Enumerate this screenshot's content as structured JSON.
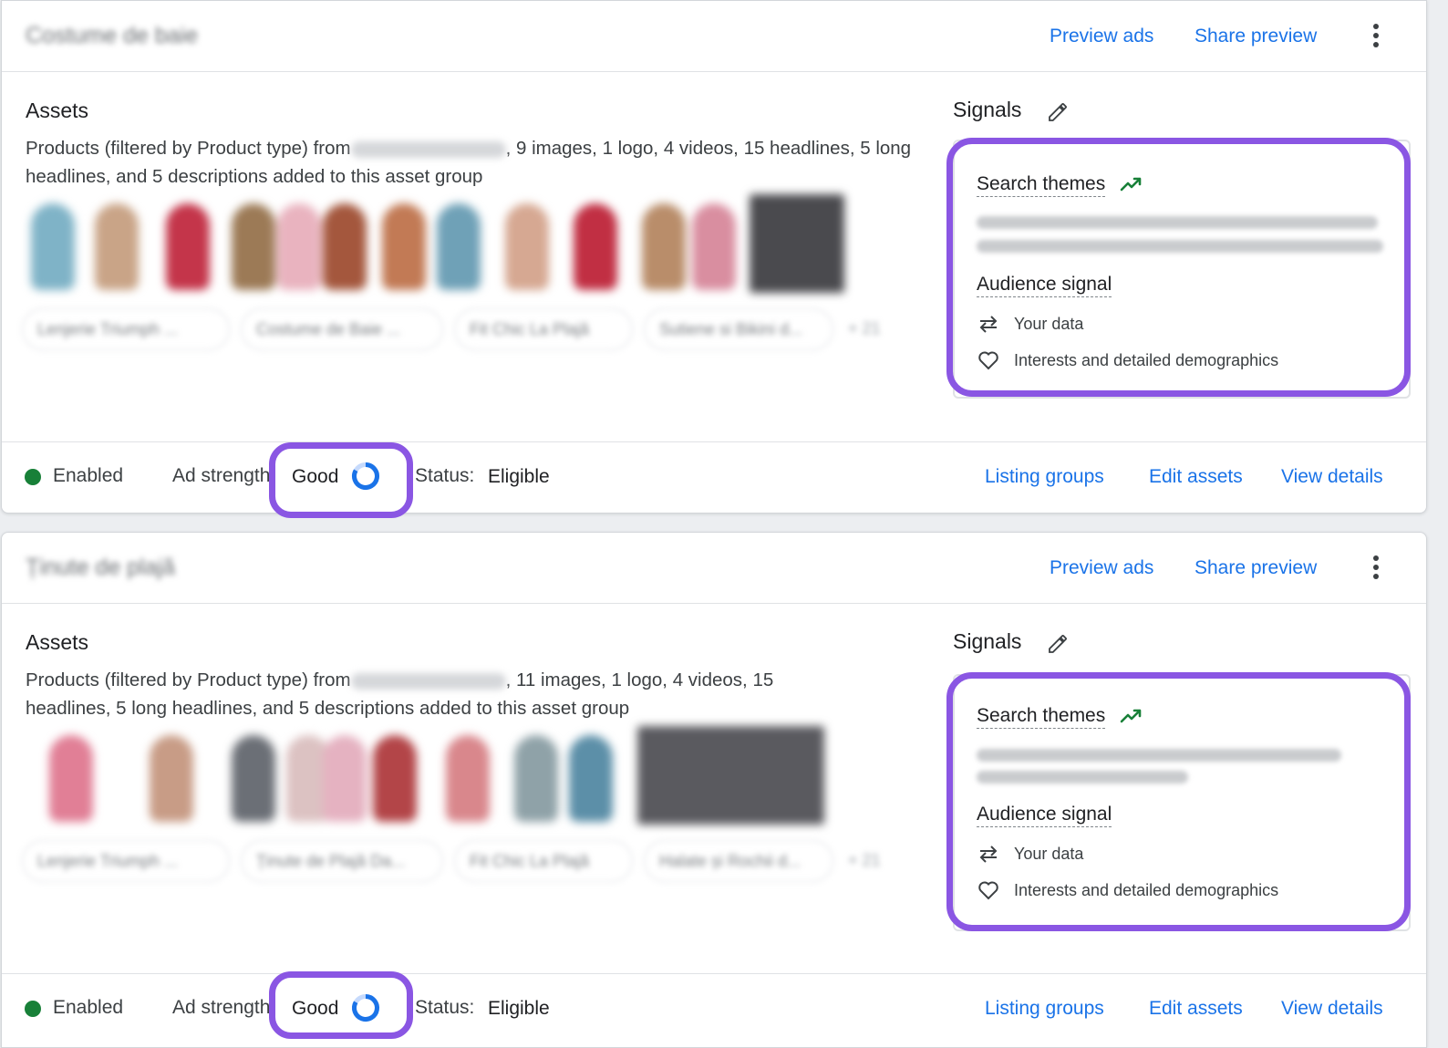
{
  "colors": {
    "link": "#1a73e8",
    "enabled_dot": "#188038",
    "highlight": "#8a56e3",
    "trend": "#188038"
  },
  "groups": [
    {
      "header": {
        "name": "Costume de baie",
        "preview_ads": "Preview ads",
        "share_preview": "Share preview",
        "more_icon": "more-vert-icon"
      },
      "assets": {
        "title": "Assets",
        "desc_prefix": "Products (filtered by Product type) from",
        "desc_source": "Lenjerie Triumph",
        "desc_suffix": ", 9 images, 1 logo, 4 videos, 15 headlines, 5 long headlines, and 5 descriptions added to this asset group",
        "product_chips": [
          "Lenjerie Triumph ...",
          "Costume de Baie ...",
          "Fit Chic La Plajă",
          "Sutiene si Bikini d..."
        ],
        "more_count": "+ 21"
      },
      "signals": {
        "title": "Signals",
        "search_themes": "Search themes",
        "themes_text": "costume de baie, costum de baie triumph, costume de baie întregi, costume de baie 2 piese, and 7 more",
        "audience_signal": "Audience signal",
        "your_data": "Your data",
        "interests": "Interests and detailed demographics"
      },
      "footer": {
        "status_enabled": "Enabled",
        "ad_strength_label": "Ad strength",
        "ad_strength_value": "Good",
        "status_label": "Status:",
        "status_value": "Eligible",
        "listing_groups": "Listing groups",
        "edit_assets": "Edit assets",
        "view_details": "View details"
      }
    },
    {
      "header": {
        "name": "Ținute de plajă",
        "preview_ads": "Preview ads",
        "share_preview": "Share preview",
        "more_icon": "more-vert-icon"
      },
      "assets": {
        "title": "Assets",
        "desc_prefix": "Products (filtered by Product type) from",
        "desc_source": "Lenjerie Triumph",
        "desc_suffix": ", 11 images, 1 logo, 4 videos, 15 headlines, 5 long headlines, and 5 descriptions added to this asset group",
        "product_chips": [
          "Lenjerie Triumph ...",
          "Ținute de Plajă Da...",
          "Fit Chic La Plajă",
          "Halate și Rochii d..."
        ],
        "more_count": "+ 21"
      },
      "signals": {
        "title": "Signals",
        "search_themes": "Search themes",
        "themes_text": "rochie de vara, rochii de plaja, kimono de plaja, halate de plaja, and 3 more",
        "audience_signal": "Audience signal",
        "your_data": "Your data",
        "interests": "Interests and detailed demographics"
      },
      "footer": {
        "status_enabled": "Enabled",
        "ad_strength_label": "Ad strength",
        "ad_strength_value": "Good",
        "status_label": "Status:",
        "status_value": "Eligible",
        "listing_groups": "Listing groups",
        "edit_assets": "Edit assets",
        "view_details": "View details"
      }
    }
  ]
}
